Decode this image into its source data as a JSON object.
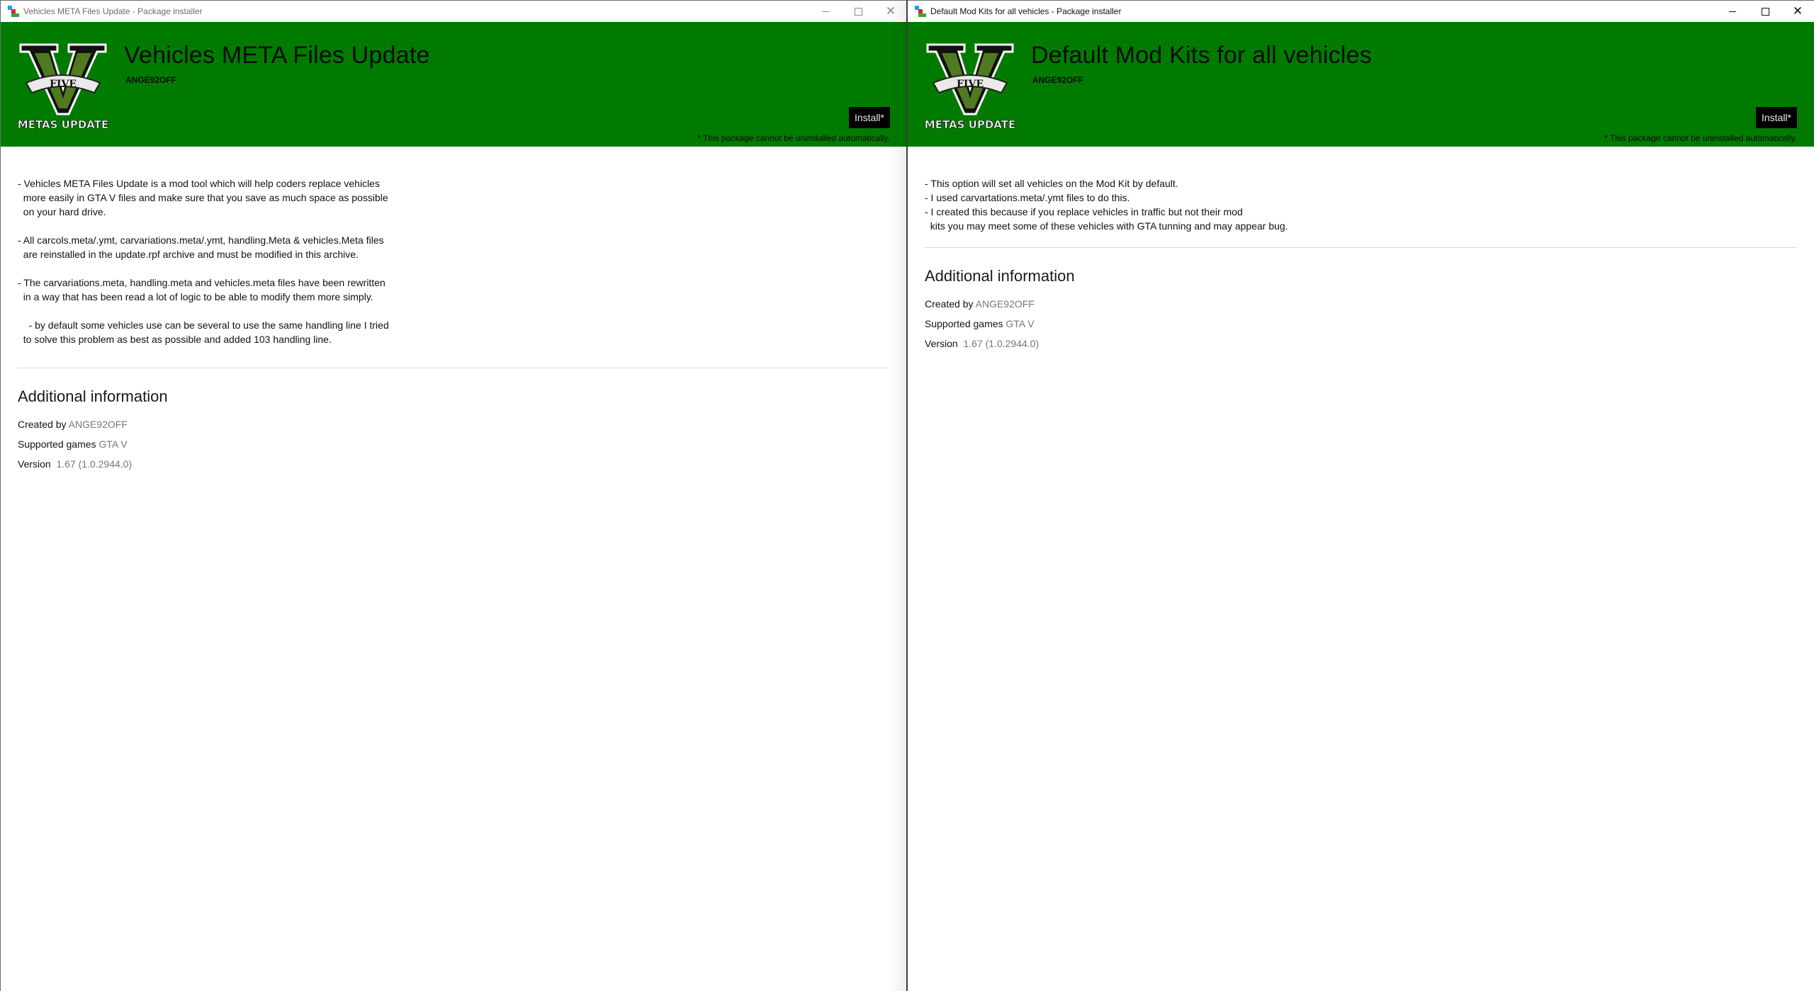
{
  "windows": [
    {
      "window_title": "Vehicles META Files Update - Package installer",
      "package_title": "Vehicles META Files Update",
      "author": "ANGE92OFF",
      "logo_text_top": "FIVE",
      "logo_text_bottom": "METAS UPDATE",
      "install_label": "Install*",
      "uninstall_note": "* This package cannot be uninstalled automatically.",
      "description": [
        "- Vehicles META Files Update is a mod tool which will help coders replace vehicles\n  more easily in GTA V files and make sure that you save as much space as possible\n  on your hard drive.",
        "- All carcols.meta/.ymt, carvariations.meta/.ymt, handling.Meta & vehicles.Meta files\n  are reinstalled in the update.rpf archive and must be modified in this archive.",
        "- The carvariations.meta, handling.meta and vehicles.meta files have been rewritten\n  in a way that has been read a lot of logic to be able to modify them more simply.",
        "    - by default some vehicles use can be several to use the same handling line I tried\n  to solve this problem as best as possible and added 103 handling line."
      ],
      "additional_info_title": "Additional information",
      "info": {
        "created_by_label": "Created by",
        "created_by_value": "ANGE92OFF",
        "supported_games_label": "Supported games",
        "supported_games_value": "GTA V",
        "version_label": "Version",
        "version_value": "1.67 (1.0.2944.0)"
      }
    },
    {
      "window_title": "Default Mod Kits for all vehicles - Package installer",
      "package_title": "Default Mod Kits for all vehicles",
      "author": "ANGE92OFF",
      "logo_text_top": "FIVE",
      "logo_text_bottom": "METAS UPDATE",
      "install_label": "Install*",
      "uninstall_note": "* This package cannot be uninstalled automatically.",
      "description": [
        "- This option will set all vehicles on the Mod Kit by default.",
        "- I used carvartations.meta/.ymt files to do this.",
        "- I created this because if you replace vehicles in traffic but not their mod\n  kits you may meet some of these vehicles with GTA tunning and may appear bug."
      ],
      "additional_info_title": "Additional information",
      "info": {
        "created_by_label": "Created by",
        "created_by_value": "ANGE92OFF",
        "supported_games_label": "Supported games",
        "supported_games_value": "GTA V",
        "version_label": "Version",
        "version_value": "1.67 (1.0.2944.0)"
      }
    }
  ],
  "colors": {
    "header_green": "#007b00",
    "install_button_bg": "#000000",
    "info_value_gray": "#777777"
  }
}
